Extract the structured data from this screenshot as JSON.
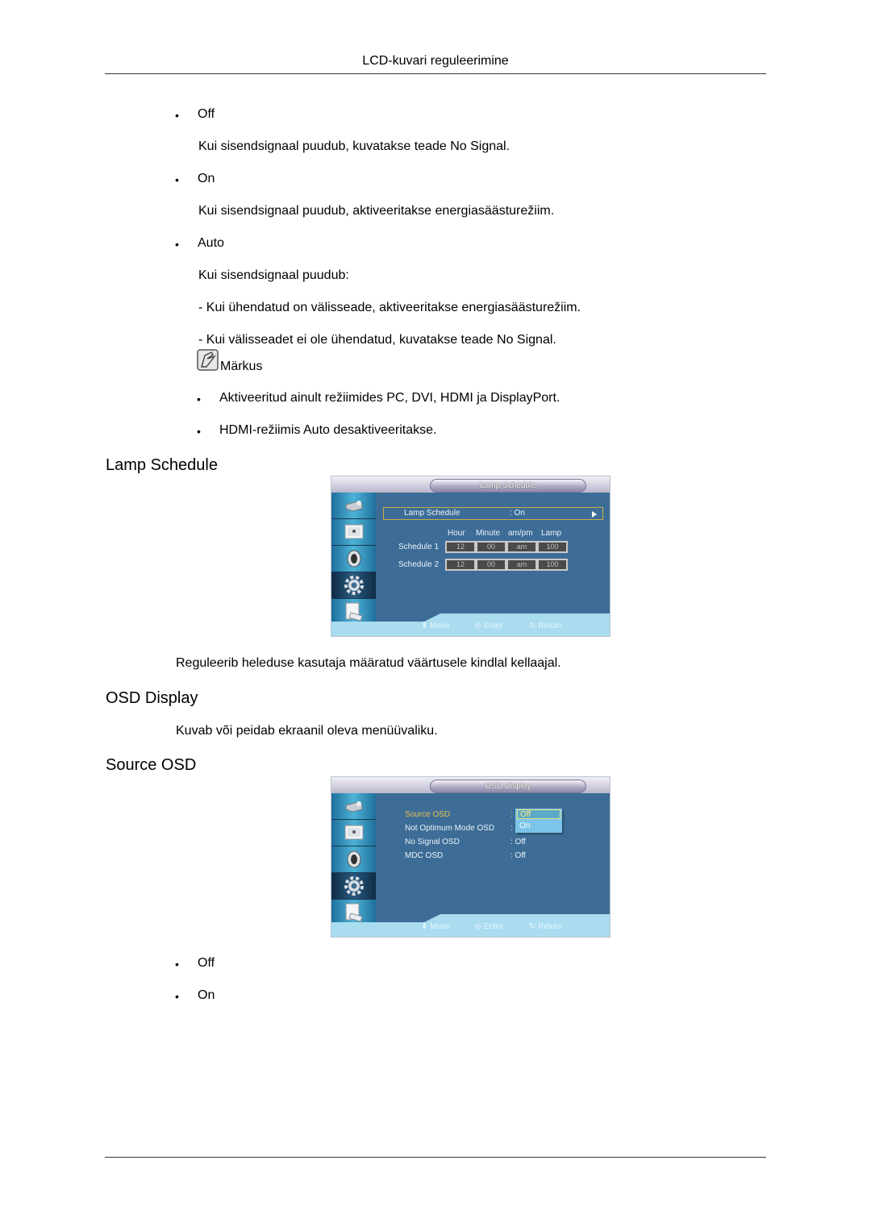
{
  "header": {
    "title": "LCD-kuvari reguleerimine"
  },
  "no_signal_options": [
    {
      "label": "Off",
      "desc_prefix": "Kui sisendsignaal puudub, kuvatakse teade ",
      "desc_bold": "No Signal",
      "desc_suffix": "."
    },
    {
      "label": "On",
      "desc": "Kui sisendsignaal puudub, aktiveeritakse energiasäästurežiim."
    },
    {
      "label": "Auto",
      "desc_lines": [
        "Kui sisendsignaal puudub:",
        "- Kui ühendatud on välisseade, aktiveeritakse energiasäästurežiim."
      ],
      "last_prefix": "- Kui välisseadet ei ole ühendatud, kuvatakse teade ",
      "last_bold": "No Signal",
      "last_suffix": "."
    }
  ],
  "note": {
    "icon": "note-pencil-icon",
    "title": "Märkus",
    "items": [
      {
        "parts": [
          "Aktiveeritud ainult režiimides ",
          "PC",
          ", ",
          "DVI",
          ", ",
          "HDMI",
          " ja ",
          "DisplayPort",
          "."
        ]
      },
      {
        "parts": [
          "HDMI",
          "-režiimis ",
          "Auto",
          " desaktiveeritakse."
        ]
      }
    ]
  },
  "lamp_schedule": {
    "heading": "Lamp Schedule",
    "osd": {
      "title": "Lamp Schedule",
      "row_label": "Lamp Schedule",
      "row_value": ": On",
      "columns": [
        "Hour",
        "Minute",
        "am/pm",
        "Lamp"
      ],
      "schedules": [
        {
          "label": "Schedule 1",
          "hour": "12",
          "minute": "00",
          "ampm": "am",
          "lamp": "100"
        },
        {
          "label": "Schedule 2",
          "hour": "12",
          "minute": "00",
          "ampm": "am",
          "lamp": "100"
        }
      ],
      "footer": {
        "move": "Move",
        "enter": "Enter",
        "return": "Return"
      }
    },
    "description": "Reguleerib heleduse kasutaja määratud väärtusele kindlal kellaajal."
  },
  "osd_display": {
    "heading": "OSD Display",
    "description": "Kuvab või peidab ekraanil oleva menüüvaliku."
  },
  "source_osd": {
    "heading": "Source OSD",
    "osd": {
      "title": "OSD Display",
      "items": [
        {
          "label": "Source OSD",
          "value": ":",
          "highlight": true
        },
        {
          "label": "Not Optimum Mode OSD",
          "value": ":"
        },
        {
          "label": "No Signal OSD",
          "value": ": Off"
        },
        {
          "label": "MDC OSD",
          "value": ": Off"
        }
      ],
      "dropdown": [
        "Off",
        "On"
      ],
      "dropdown_selected": "Off",
      "footer": {
        "move": "Move",
        "enter": "Enter",
        "return": "Return"
      }
    },
    "options": [
      "Off",
      "On"
    ]
  },
  "colors": {
    "osd_bg": "#3d6d96",
    "osd_highlight": "#e8c050",
    "osd_footer": "#aadcf0"
  }
}
